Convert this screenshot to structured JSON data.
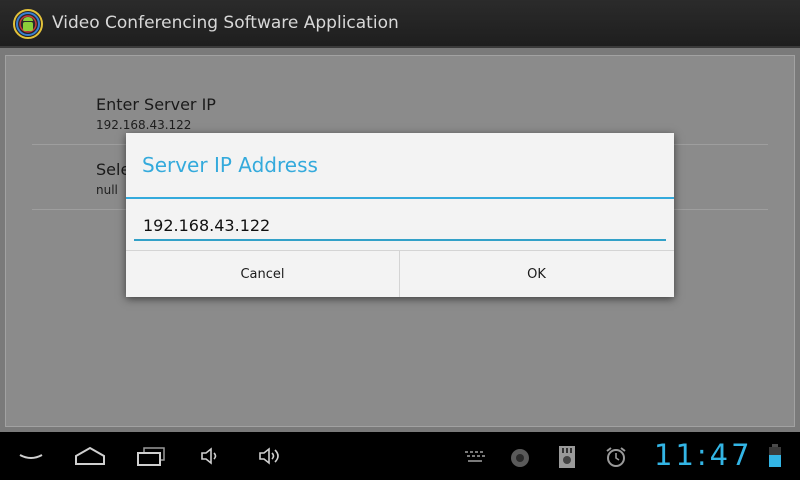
{
  "app": {
    "title": "Video Conferencing Software Application"
  },
  "preferences": [
    {
      "title": "Enter Server IP",
      "summary": "192.168.43.122"
    },
    {
      "title": "Sele",
      "summary": "null"
    }
  ],
  "dialog": {
    "title": "Server IP Address",
    "input_value": "192.168.43.122",
    "cancel_label": "Cancel",
    "ok_label": "OK"
  },
  "navbar": {
    "buttons": [
      "back-icon",
      "home-icon",
      "recent-apps-icon",
      "volume-down-icon",
      "volume-up-icon"
    ]
  },
  "status": {
    "time": "11:47",
    "icons": [
      "keyboard-icon",
      "notification-icon",
      "sd-card-icon",
      "alarm-icon",
      "battery-icon"
    ]
  },
  "colors": {
    "accent": "#33b5e5",
    "dialog_title": "#34aadc"
  }
}
